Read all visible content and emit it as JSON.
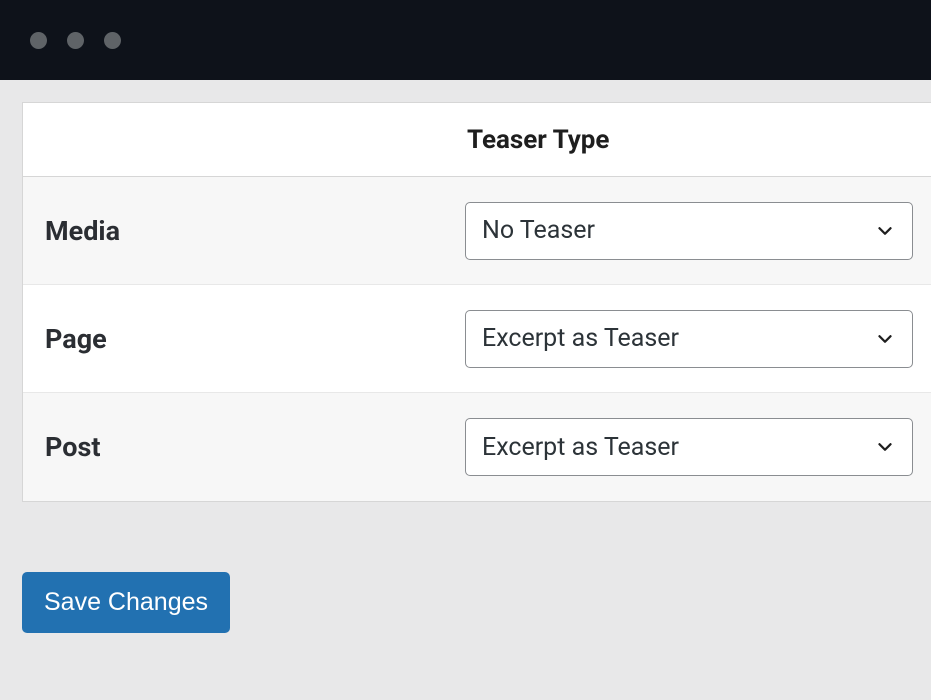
{
  "header": {
    "column_label": "Teaser Type"
  },
  "rows": [
    {
      "label": "Media",
      "value": "No Teaser"
    },
    {
      "label": "Page",
      "value": "Excerpt as Teaser"
    },
    {
      "label": "Post",
      "value": "Excerpt as Teaser"
    }
  ],
  "actions": {
    "save_label": "Save Changes"
  }
}
